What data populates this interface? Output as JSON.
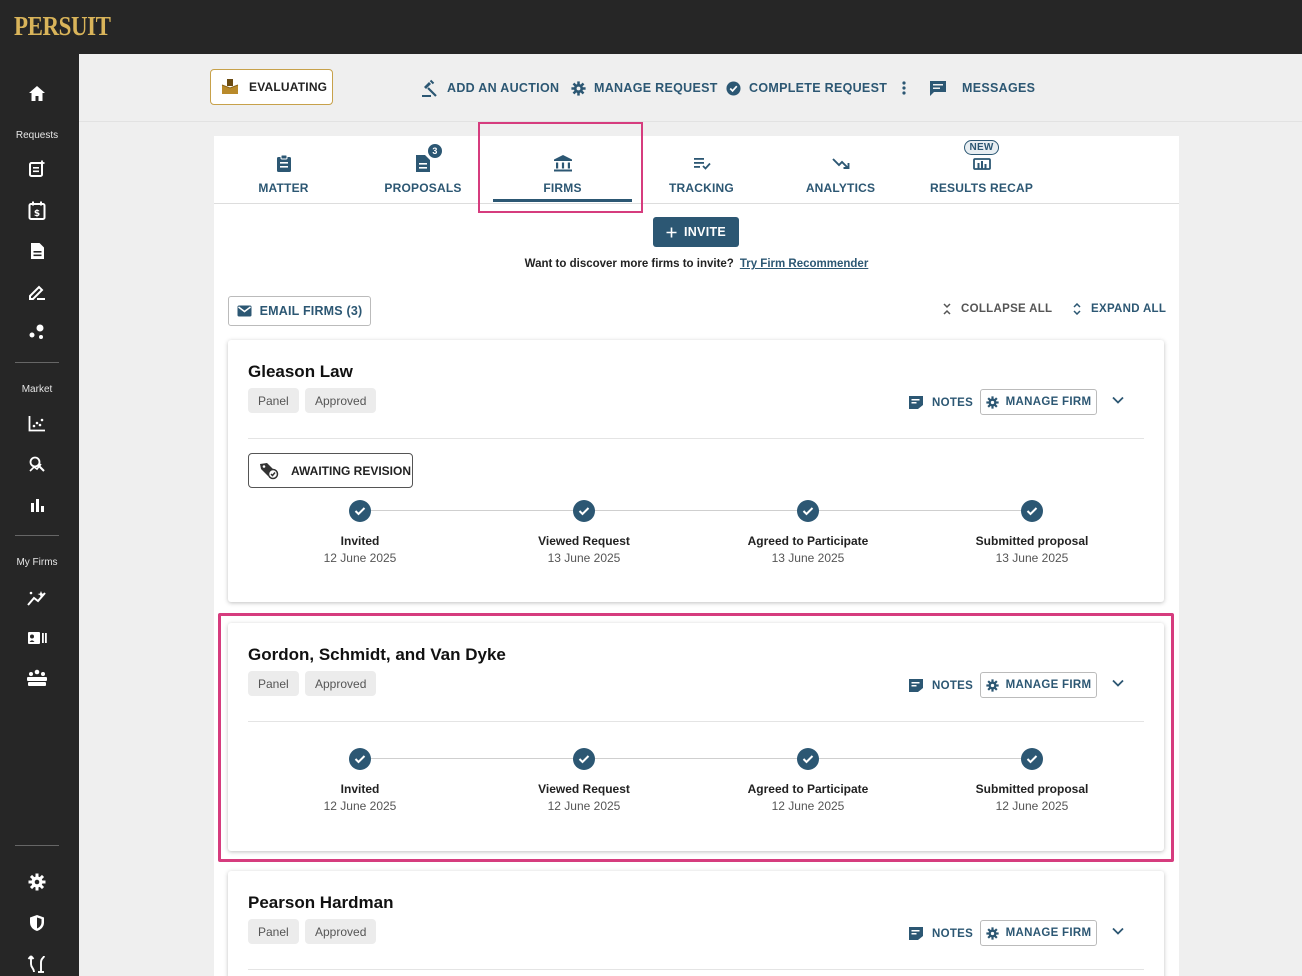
{
  "brand": "PERSUIT",
  "sidebar": {
    "sections": [
      "Requests",
      "Market",
      "My Firms"
    ]
  },
  "actionbar": {
    "status": "EVALUATING",
    "add_auction": "ADD AN AUCTION",
    "manage_request": "MANAGE REQUEST",
    "complete_request": "COMPLETE REQUEST",
    "messages": "MESSAGES"
  },
  "tabs": [
    {
      "label": "MATTER"
    },
    {
      "label": "PROPOSALS",
      "badge": "3"
    },
    {
      "label": "FIRMS"
    },
    {
      "label": "TRACKING"
    },
    {
      "label": "ANALYTICS"
    },
    {
      "label": "RESULTS RECAP",
      "badge": "NEW"
    }
  ],
  "invite": {
    "button": "INVITE",
    "prompt": "Want to discover more firms to invite?",
    "link": "Try Firm Recommender"
  },
  "toolbar": {
    "email_firms": "EMAIL FIRMS (3)",
    "collapse_all": "COLLAPSE ALL",
    "expand_all": "EXPAND ALL"
  },
  "card_actions": {
    "notes": "NOTES",
    "manage_firm": "MANAGE FIRM"
  },
  "firms": [
    {
      "name": "Gleason Law",
      "chips": [
        "Panel",
        "Approved"
      ],
      "status": "AWAITING REVISION",
      "steps": [
        {
          "label": "Invited",
          "date": "12 June 2025"
        },
        {
          "label": "Viewed Request",
          "date": "13 June 2025"
        },
        {
          "label": "Agreed to Participate",
          "date": "13 June 2025"
        },
        {
          "label": "Submitted proposal",
          "date": "13 June 2025"
        }
      ]
    },
    {
      "name": "Gordon, Schmidt, and Van Dyke",
      "chips": [
        "Panel",
        "Approved"
      ],
      "steps": [
        {
          "label": "Invited",
          "date": "12 June 2025"
        },
        {
          "label": "Viewed Request",
          "date": "12 June 2025"
        },
        {
          "label": "Agreed to Participate",
          "date": "12 June 2025"
        },
        {
          "label": "Submitted proposal",
          "date": "12 June 2025"
        }
      ]
    },
    {
      "name": "Pearson Hardman",
      "chips": [
        "Panel",
        "Approved"
      ]
    }
  ]
}
